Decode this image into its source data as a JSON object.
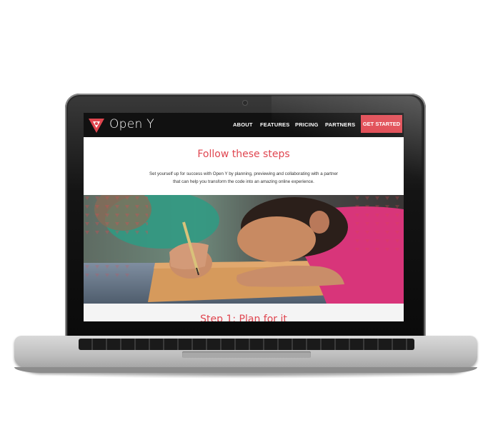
{
  "site": {
    "brand": "Open Y",
    "nav": {
      "about": "ABOUT",
      "features": "FEATURES",
      "pricing": "PRICING",
      "partners": "PARTNERS",
      "cta": "GET STARTED"
    },
    "hero": {
      "title": "Follow these steps",
      "desc_line1": "Set yourself up for success with Open Y by planning, previewing and collaborating with a partner",
      "desc_line2": "that can help you transform the code into an amazing online experience."
    },
    "step": {
      "title": "Step 1: Plan for it"
    }
  },
  "colors": {
    "accent": "#e0454e",
    "nav_bg": "#111111",
    "text": "#333333"
  },
  "icons": {
    "logo": "open-y-logo-icon"
  }
}
